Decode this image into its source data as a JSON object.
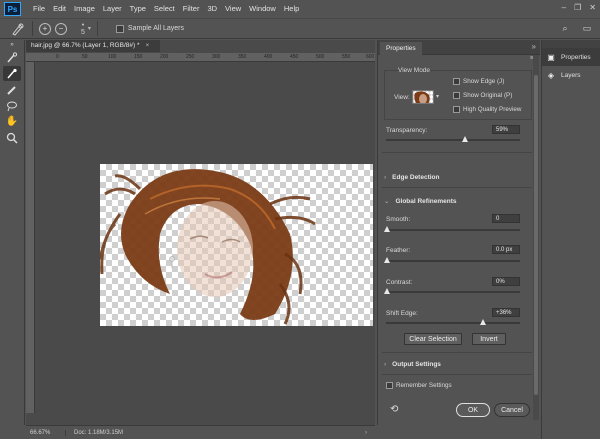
{
  "app": {
    "logo": "Ps",
    "menu": [
      "File",
      "Edit",
      "Image",
      "Layer",
      "Type",
      "Select",
      "Filter",
      "3D",
      "View",
      "Window",
      "Help"
    ],
    "window_controls": [
      "–",
      "❐",
      "✕"
    ]
  },
  "options_bar": {
    "brush_size": "5",
    "sample_all_layers_label": "Sample All Layers",
    "sample_all_layers_checked": false
  },
  "document": {
    "tab_title": "hair.jpg @ 66.7% (Layer 1, RGB/8#) *",
    "tab_close": "×",
    "ruler_ticks": [
      "0",
      "50",
      "100",
      "150",
      "200",
      "250",
      "300",
      "350",
      "400",
      "450",
      "500",
      "550",
      "600"
    ],
    "zoom": "66.67%",
    "doc_info": "Doc: 1.18M/3.15M"
  },
  "properties": {
    "tab_label": "Properties",
    "view_mode_title": "View Mode",
    "view_label": "View:",
    "show_edge_label": "Show Edge (J)",
    "show_original_label": "Show Original (P)",
    "high_quality_label": "High Quality Preview",
    "transparency_label": "Transparency:",
    "transparency_value": "59%",
    "transparency_level": 0.59,
    "edge_detection_label": "Edge Detection",
    "global_refinements_label": "Global Refinements",
    "smooth_label": "Smooth:",
    "smooth_value": "0",
    "feather_label": "Feather:",
    "feather_value": "0.0 px",
    "contrast_label": "Contrast:",
    "contrast_value": "0%",
    "shift_edge_label": "Shift Edge:",
    "shift_edge_value": "+36%",
    "clear_selection_label": "Clear Selection",
    "invert_label": "Invert",
    "output_settings_label": "Output Settings",
    "remember_settings_label": "Remember Settings",
    "ok_label": "OK",
    "cancel_label": "Cancel"
  },
  "dock": {
    "items": [
      {
        "label": "Properties",
        "icon": "properties-icon"
      },
      {
        "label": "Layers",
        "icon": "layers-icon"
      }
    ]
  }
}
